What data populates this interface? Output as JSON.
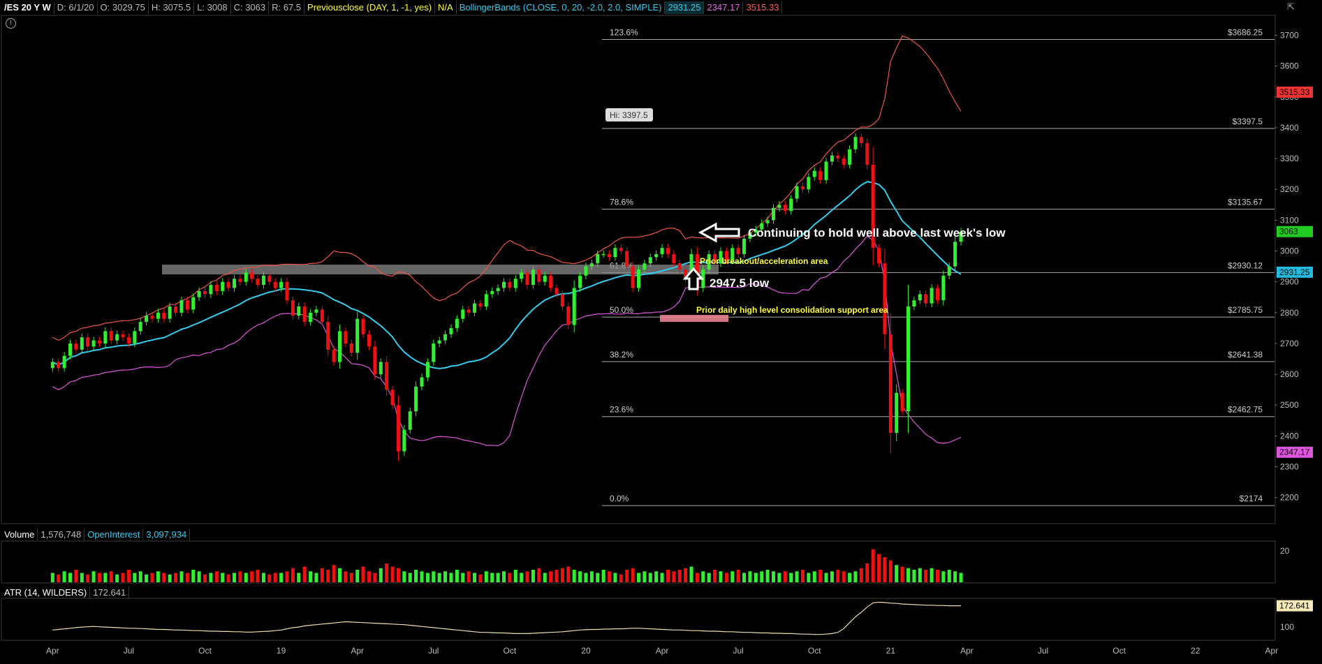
{
  "header": {
    "symbol": "/ES 20 Y W",
    "date": "D: 6/1/20",
    "open": "O: 3029.75",
    "high": "H: 3075.5",
    "low": "L: 3008",
    "close": "C: 3063",
    "range": "R: 67.5",
    "prev_close_label": "Previousclose (DAY, 1, -1, yes)",
    "prev_close_value": "N/A",
    "bb_label": "BollingerBands (CLOSE, 0, 20, -2.0, 2.0, SIMPLE)",
    "bb_mid": "2931.25",
    "bb_low": "2347.17",
    "bb_up": "3515.33"
  },
  "volume_header": {
    "label": "Volume",
    "volume": "1,576,748",
    "oi_label": "OpenInterest",
    "oi": "3,097,934"
  },
  "atr_header": {
    "label": "ATR (14, WILDERS)",
    "value": "172.641"
  },
  "colors": {
    "up": "#33ee33",
    "down": "#ee1111",
    "mid": "#33ccee",
    "upper": "#ee5544",
    "lower": "#dd55dd",
    "atr": "#eeddaa"
  },
  "chart_data": {
    "type": "candlestick",
    "ylim": [
      2120,
      3760
    ],
    "y_ticks": [
      2200,
      2300,
      2400,
      2500,
      2600,
      2700,
      2800,
      2900,
      3000,
      3100,
      3200,
      3300,
      3400,
      3500,
      3600,
      3700
    ],
    "x_ticks": [
      "Apr",
      "Jul",
      "Oct",
      "19",
      "Apr",
      "Jul",
      "Oct",
      "20",
      "Apr",
      "Jul",
      "Oct",
      "21",
      "Apr",
      "Jul",
      "Oct",
      "22",
      "Apr"
    ],
    "x_tick_weeks": [
      0,
      13,
      26,
      39,
      52,
      65,
      78,
      91,
      104,
      117,
      130,
      143,
      156,
      169,
      182,
      195,
      208
    ],
    "start_offset": -8,
    "weeks_total": 217,
    "fib_levels": [
      {
        "pct": "123.6%",
        "price": 3686.25,
        "label": "$3686.25"
      },
      {
        "pct": "",
        "price": 3397.5,
        "label": "$3397.5"
      },
      {
        "pct": "78.6%",
        "price": 3135.67,
        "label": "$3135.67"
      },
      {
        "pct": "61.8%",
        "price": 2930.12,
        "label": "$2930.12"
      },
      {
        "pct": "50.0%",
        "price": 2785.75,
        "label": "$2785.75"
      },
      {
        "pct": "38.2%",
        "price": 2641.38,
        "label": "$2641.38"
      },
      {
        "pct": "23.6%",
        "price": 2462.75,
        "label": "$2462.75"
      },
      {
        "pct": "0.0%",
        "price": 2174,
        "label": "$2174"
      }
    ],
    "price_tags": [
      {
        "value": 3515.33,
        "label": "3515.33",
        "color": "#ee3333"
      },
      {
        "value": 3063,
        "label": "3063",
        "color": "#22cc22"
      },
      {
        "value": 2931.25,
        "label": "2931.25",
        "color": "#22bbdd"
      },
      {
        "value": 2347.17,
        "label": "2347.17",
        "color": "#dd55dd"
      }
    ],
    "hi_label": "Hi: 3397.5",
    "annotations": {
      "hold": "Continuing to hold well above last week's low",
      "breakout": "Prior breakout/acceleration area",
      "low": "2947.5 low",
      "consolidation": "Prior daily high level consolidation support area"
    },
    "closes": [
      2640,
      2620,
      2660,
      2700,
      2680,
      2720,
      2690,
      2710,
      2700,
      2740,
      2710,
      2730,
      2720,
      2700,
      2740,
      2770,
      2790,
      2780,
      2800,
      2780,
      2820,
      2800,
      2840,
      2810,
      2850,
      2870,
      2860,
      2890,
      2870,
      2900,
      2880,
      2910,
      2900,
      2930,
      2910,
      2890,
      2920,
      2900,
      2880,
      2900,
      2840,
      2790,
      2820,
      2770,
      2800,
      2810,
      2770,
      2680,
      2640,
      2740,
      2700,
      2670,
      2780,
      2730,
      2690,
      2600,
      2640,
      2550,
      2500,
      2350,
      2420,
      2480,
      2560,
      2590,
      2640,
      2700,
      2710,
      2730,
      2750,
      2780,
      2810,
      2800,
      2830,
      2820,
      2860,
      2870,
      2880,
      2900,
      2880,
      2910,
      2930,
      2890,
      2940,
      2900,
      2920,
      2880,
      2860,
      2820,
      2760,
      2880,
      2920,
      2950,
      2960,
      2990,
      2990,
      2980,
      3010,
      3000,
      2950,
      2880,
      2940,
      2960,
      2980,
      2990,
      3010,
      2990,
      2960,
      2940,
      2910,
      2990,
      2880,
      2940,
      2990,
      2960,
      3000,
      2970,
      3010,
      2990,
      3040,
      3060,
      3070,
      3090,
      3100,
      3140,
      3150,
      3130,
      3170,
      3210,
      3200,
      3240,
      3260,
      3230,
      3290,
      3310,
      3300,
      3280,
      3330,
      3370,
      3350,
      3280,
      3010,
      2960,
      2730,
      2410,
      2540,
      2480,
      2820,
      2840,
      2860,
      2830,
      2880,
      2840,
      2920,
      2950,
      3030,
      3063
    ],
    "volume": [
      6,
      5,
      7,
      6,
      8,
      6,
      5,
      7,
      6,
      6,
      7,
      5,
      6,
      8,
      6,
      7,
      5,
      6,
      7,
      6,
      5,
      6,
      7,
      6,
      8,
      7,
      5,
      6,
      7,
      6,
      5,
      6,
      7,
      6,
      7,
      8,
      6,
      5,
      6,
      6,
      7,
      9,
      6,
      10,
      7,
      6,
      9,
      8,
      11,
      9,
      7,
      6,
      8,
      10,
      7,
      6,
      9,
      12,
      10,
      9,
      7,
      6,
      8,
      7,
      6,
      7,
      6,
      7,
      6,
      8,
      6,
      7,
      6,
      5,
      7,
      6,
      6,
      7,
      6,
      8,
      6,
      7,
      8,
      9,
      6,
      7,
      8,
      9,
      10,
      8,
      7,
      6,
      7,
      6,
      8,
      7,
      6,
      5,
      8,
      9,
      6,
      7,
      6,
      7,
      6,
      8,
      7,
      8,
      9,
      10,
      6,
      7,
      6,
      8,
      7,
      6,
      7,
      8,
      6,
      7,
      6,
      7,
      8,
      7,
      6,
      7,
      6,
      7,
      8,
      6,
      7,
      8,
      6,
      7,
      8,
      7,
      6,
      7,
      9,
      12,
      21,
      18,
      16,
      14,
      11,
      10,
      9,
      8,
      9,
      8,
      9,
      8,
      7,
      8,
      7,
      6
    ],
    "atr": [
      90,
      92,
      94,
      96,
      98,
      100,
      101,
      102,
      101,
      100,
      99,
      98,
      97,
      96,
      96,
      95,
      94,
      93,
      92,
      92,
      91,
      90,
      90,
      89,
      88,
      88,
      87,
      86,
      86,
      85,
      85,
      84,
      84,
      83,
      83,
      84,
      85,
      86,
      88,
      90,
      94,
      98,
      100,
      104,
      106,
      108,
      110,
      112,
      114,
      116,
      118,
      117,
      116,
      115,
      114,
      113,
      112,
      111,
      110,
      109,
      108,
      106,
      104,
      102,
      100,
      98,
      96,
      94,
      92,
      90,
      88,
      86,
      84,
      82,
      82,
      81,
      80,
      80,
      79,
      78,
      78,
      78,
      79,
      80,
      81,
      82,
      83,
      84,
      86,
      88,
      90,
      91,
      92,
      92,
      93,
      93,
      94,
      94,
      95,
      96,
      96,
      95,
      94,
      93,
      92,
      91,
      90,
      90,
      89,
      88,
      88,
      87,
      86,
      86,
      85,
      84,
      84,
      83,
      82,
      82,
      81,
      80,
      80,
      79,
      79,
      78,
      78,
      77,
      76,
      76,
      75,
      75,
      76,
      78,
      82,
      95,
      115,
      135,
      150,
      168,
      182,
      184,
      183,
      181,
      180,
      178,
      177,
      176,
      175,
      174,
      174,
      173,
      173,
      172,
      172,
      172
    ]
  }
}
